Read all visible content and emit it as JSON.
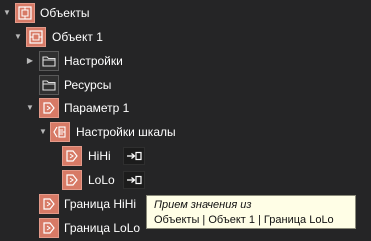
{
  "tree": {
    "items": [
      {
        "label": "Объекты"
      },
      {
        "label": "Объект 1"
      },
      {
        "label": "Настройки"
      },
      {
        "label": "Ресурсы"
      },
      {
        "label": "Параметр 1"
      },
      {
        "label": "Настройки шкалы"
      },
      {
        "label": "HiHi",
        "action_icon": "link-source-icon"
      },
      {
        "label": "LoLo",
        "action_icon": "link-source-icon"
      },
      {
        "label": "Граница HiHi"
      },
      {
        "label": "Граница LoLo"
      }
    ]
  },
  "tooltip": {
    "title": "Прием значения из",
    "path": "Объекты | Объект 1 | Граница LoLo"
  },
  "colors": {
    "background": "#252526",
    "node_icon": "#d77a66",
    "folder_icon_bg": "#303030",
    "tooltip_bg": "#fffee6"
  }
}
